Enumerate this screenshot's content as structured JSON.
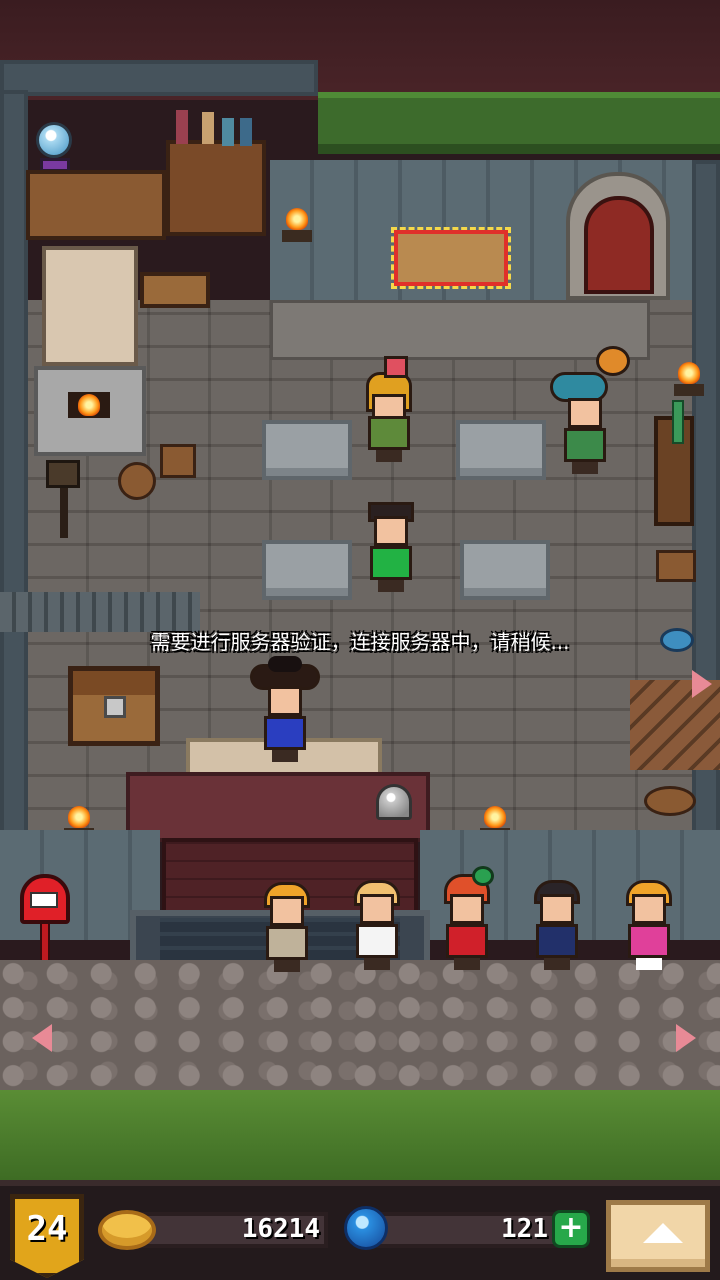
{
  "status_message": "需要进行服务器验证，连接服务器中，请稍候...",
  "hud": {
    "level": "24",
    "gold": "16214",
    "gems": "121",
    "plus_label": "+"
  },
  "icons": {
    "level_badge": "shield-badge-icon",
    "gold": "gold-coin-icon",
    "gems": "blue-gem-icon",
    "add_gems": "plus-icon",
    "expand": "up-triangle-icon",
    "mailbox": "mailbox-icon",
    "crystal_ball": "crystal-ball-icon",
    "bell": "service-bell-icon"
  },
  "colors": {
    "badge": "#e1a51b",
    "plus": "#27a84a",
    "gem": "#2a8ee0",
    "coin": "#f1c04a",
    "torch": "#ff9a1a"
  }
}
